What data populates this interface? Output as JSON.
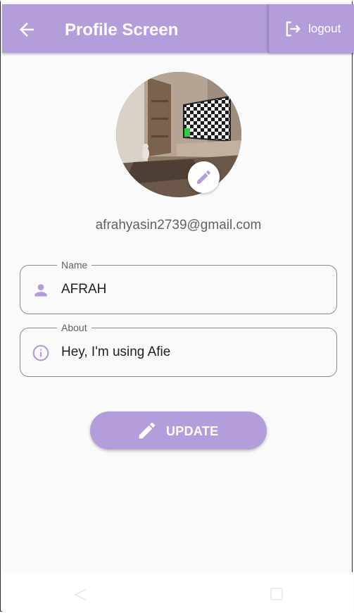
{
  "appbar": {
    "title": "Profile Screen",
    "back_icon": "arrow-left-icon",
    "logout_label": "logout",
    "logout_icon": "logout-icon",
    "background_color": "#b39ddb"
  },
  "profile": {
    "avatar_image": "living room with checkerboard TV screen",
    "edit_icon": "pencil-icon",
    "email": "afrahyasin2739@gmail.com"
  },
  "form": {
    "name": {
      "label": "Name",
      "value": "AFRAH",
      "icon": "person-icon"
    },
    "about": {
      "label": "About",
      "value": "Hey, I'm using Afie",
      "icon": "info-icon"
    }
  },
  "update_button": {
    "label": "UPDATE",
    "icon": "pencil-icon"
  },
  "navbar": {
    "back_icon": "nav-back-icon",
    "recents_icon": "nav-recents-icon"
  },
  "colors": {
    "accent": "#b39ddb",
    "icon_accent": "#b39ddb",
    "text_primary": "#212121",
    "text_secondary": "#616161"
  }
}
